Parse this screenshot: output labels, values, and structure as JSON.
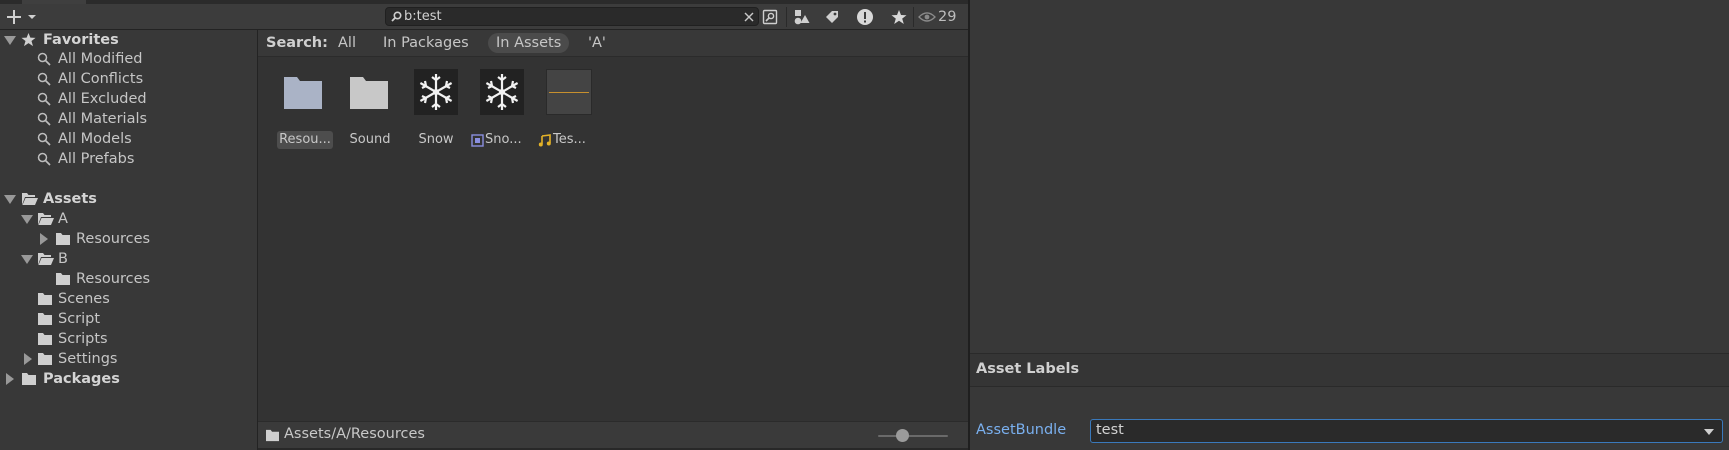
{
  "toolbar": {
    "create_icon": "plus-icon",
    "search": {
      "value": "b:test",
      "placeholder": ""
    },
    "hidden_count": "29"
  },
  "tree": {
    "favorites": {
      "label": "Favorites",
      "items": [
        "All Modified",
        "All Conflicts",
        "All Excluded",
        "All Materials",
        "All Models",
        "All Prefabs"
      ]
    },
    "assets": {
      "label": "Assets",
      "a": {
        "label": "A",
        "resources": "Resources"
      },
      "b": {
        "label": "B",
        "resources": "Resources"
      },
      "scenes": "Scenes",
      "script": "Script",
      "scripts": "Scripts",
      "settings": "Settings"
    },
    "packages": "Packages"
  },
  "filter": {
    "label": "Search:",
    "options": [
      "All",
      "In Packages",
      "In Assets",
      "'A'"
    ],
    "active": "In Assets"
  },
  "grid": {
    "items": [
      {
        "label": "Resou...",
        "kind": "folder",
        "selected": true
      },
      {
        "label": "Sound",
        "kind": "folder",
        "selected": false
      },
      {
        "label": "Snow",
        "kind": "texture",
        "selected": false
      },
      {
        "label": "Sno...",
        "kind": "sprite",
        "selected": false
      },
      {
        "label": "Tes...",
        "kind": "audio",
        "selected": false
      }
    ]
  },
  "footer": {
    "path": "Assets/A/Resources"
  },
  "inspector": {
    "labels_title": "Asset Labels",
    "assetbundle_label": "AssetBundle",
    "assetbundle_value": "test"
  },
  "colors": {
    "accent": "#3a79bb",
    "link": "#7ab0ef",
    "panel": "#383838"
  }
}
